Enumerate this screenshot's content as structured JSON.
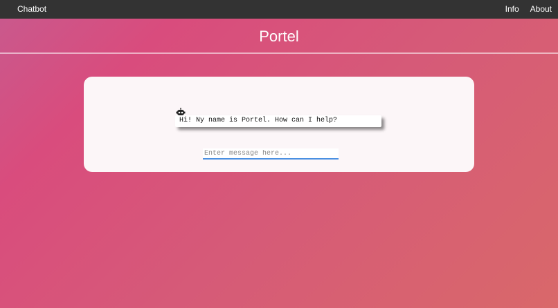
{
  "navbar": {
    "brand": "Chatbot",
    "links": [
      {
        "label": "Info"
      },
      {
        "label": "About"
      }
    ]
  },
  "header": {
    "title": "Portel"
  },
  "chat": {
    "bot_message": "Hi! Ny name is Portel. How can I help?",
    "input": {
      "placeholder": "Enter message here...",
      "value": ""
    }
  },
  "colors": {
    "navbar": "#333333",
    "card": "#fcf6f8",
    "input_underline": "#4a90e2",
    "gradient_start": "#c85a8e",
    "gradient_end": "#d9686a"
  },
  "icons": {
    "bot": "robot-icon"
  }
}
